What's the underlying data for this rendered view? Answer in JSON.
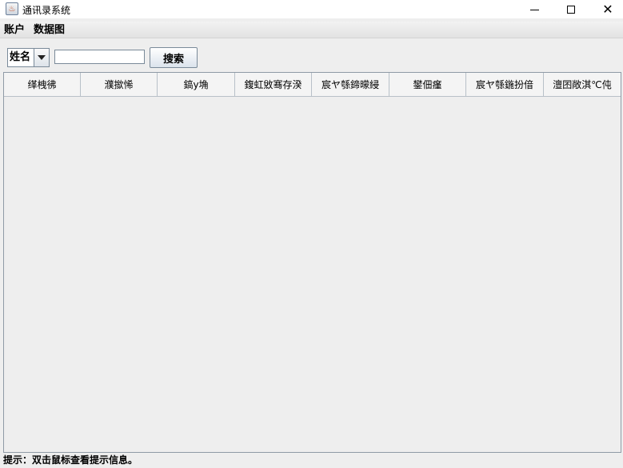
{
  "window": {
    "title": "通讯录系统",
    "icon": "java-cup-icon"
  },
  "menubar": {
    "items": [
      "账户",
      "数据图"
    ]
  },
  "toolbar": {
    "search_field_selected": "姓名",
    "search_input_value": "",
    "search_button_label": "搜索"
  },
  "table": {
    "columns": [
      "缂栧彿",
      "濮撳悕",
      "鎬у埆",
      "鍑虹敓骞存湀",
      "宸ヤ綔鍗曚綅",
      "鐢佃瘽",
      "宸ヤ綔鍦扮偣",
      "澶囨敞淇℃伅"
    ],
    "rows": []
  },
  "status_bar": {
    "text": "提示：双击鼠标查看提示信息。"
  }
}
